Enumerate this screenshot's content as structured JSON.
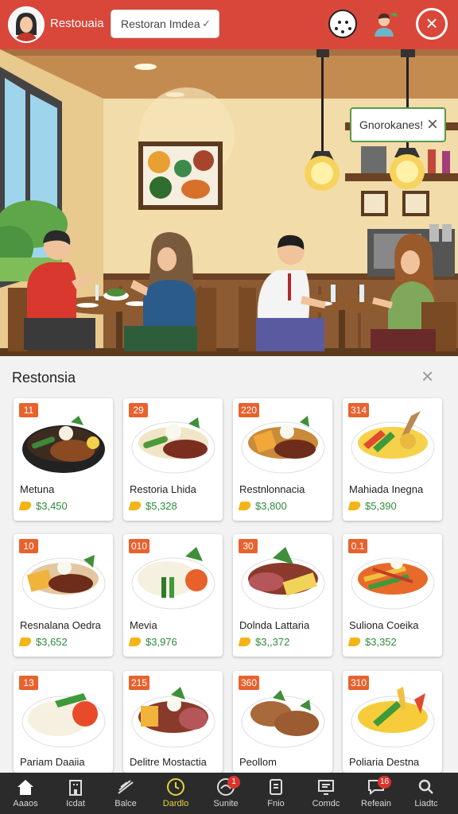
{
  "header": {
    "app_title": "Restouaia",
    "search_value": "Restoran Imdea",
    "icons": [
      "avatar",
      "smiley-icon",
      "profile-icon",
      "close-icon"
    ]
  },
  "toast": {
    "label": "Gnorokanes!"
  },
  "panel": {
    "title": "Restonsia",
    "items": [
      {
        "num": "11",
        "name": "Metuna",
        "price": "$3,450"
      },
      {
        "num": "29",
        "name": "Restoria Lhida",
        "price": "$5,328"
      },
      {
        "num": "220",
        "name": "Restnlonnacia",
        "price": "$3,800"
      },
      {
        "num": "314",
        "name": "Mahiada Inegna",
        "price": "$5,390"
      },
      {
        "num": "10",
        "name": "Resnalana Oedra",
        "price": "$3,652"
      },
      {
        "num": "010",
        "name": "Mevia",
        "price": "$3,976"
      },
      {
        "num": "30",
        "name": "Dolnda Lattaria",
        "price": "$3,,372"
      },
      {
        "num": "0.1",
        "name": "Suliona Coeika",
        "price": "$3,352"
      },
      {
        "num": "13",
        "name": "Pariam Daaiia",
        "price": ""
      },
      {
        "num": "215",
        "name": "Delitre Mostactia",
        "price": ""
      },
      {
        "num": "360",
        "name": "Peollom",
        "price": ""
      },
      {
        "num": "310",
        "name": "Poliaria Destna",
        "price": ""
      }
    ]
  },
  "nav": [
    {
      "label": "Aaaos",
      "icon": "home-icon",
      "badge": ""
    },
    {
      "label": "Icdat",
      "icon": "building-icon",
      "badge": ""
    },
    {
      "label": "Balce",
      "icon": "flag-icon",
      "badge": ""
    },
    {
      "label": "Dardlo",
      "icon": "clock-icon",
      "badge": ""
    },
    {
      "label": "Sunite",
      "icon": "globe-icon",
      "badge": "1"
    },
    {
      "label": "Fnio",
      "icon": "document-icon",
      "badge": ""
    },
    {
      "label": "Comdc",
      "icon": "monitor-icon",
      "badge": ""
    },
    {
      "label": "Refeain",
      "icon": "chat-icon",
      "badge": "16"
    },
    {
      "label": "Liadtc",
      "icon": "search-icon",
      "badge": ""
    }
  ],
  "colors": {
    "header_red": "#d9473a",
    "price_green": "#2f8a3c",
    "tag_orange": "#e8622e",
    "nav_active": "#e5d23f"
  }
}
